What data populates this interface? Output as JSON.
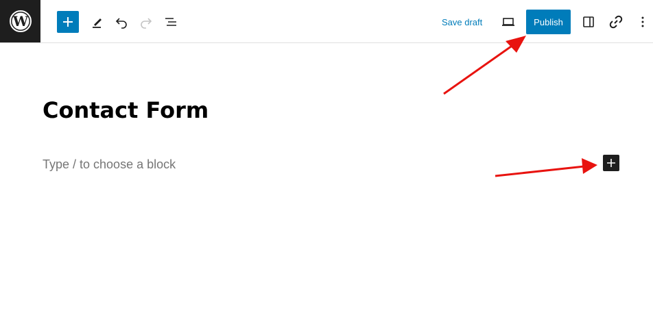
{
  "toolbar": {
    "save_draft_label": "Save draft",
    "publish_label": "Publish",
    "icons": [
      "wordpress-icon",
      "plus-icon",
      "pencil-icon",
      "undo-icon",
      "redo-icon",
      "list-view-icon",
      "desktop-preview-icon",
      "sidebar-icon",
      "link-icon",
      "more-vertical-icon"
    ],
    "accent_color": "#007cba"
  },
  "editor": {
    "post_title": "Contact Form",
    "block_placeholder": "Type / to choose a block"
  },
  "annotations": {
    "arrow_color": "#e8130f"
  }
}
